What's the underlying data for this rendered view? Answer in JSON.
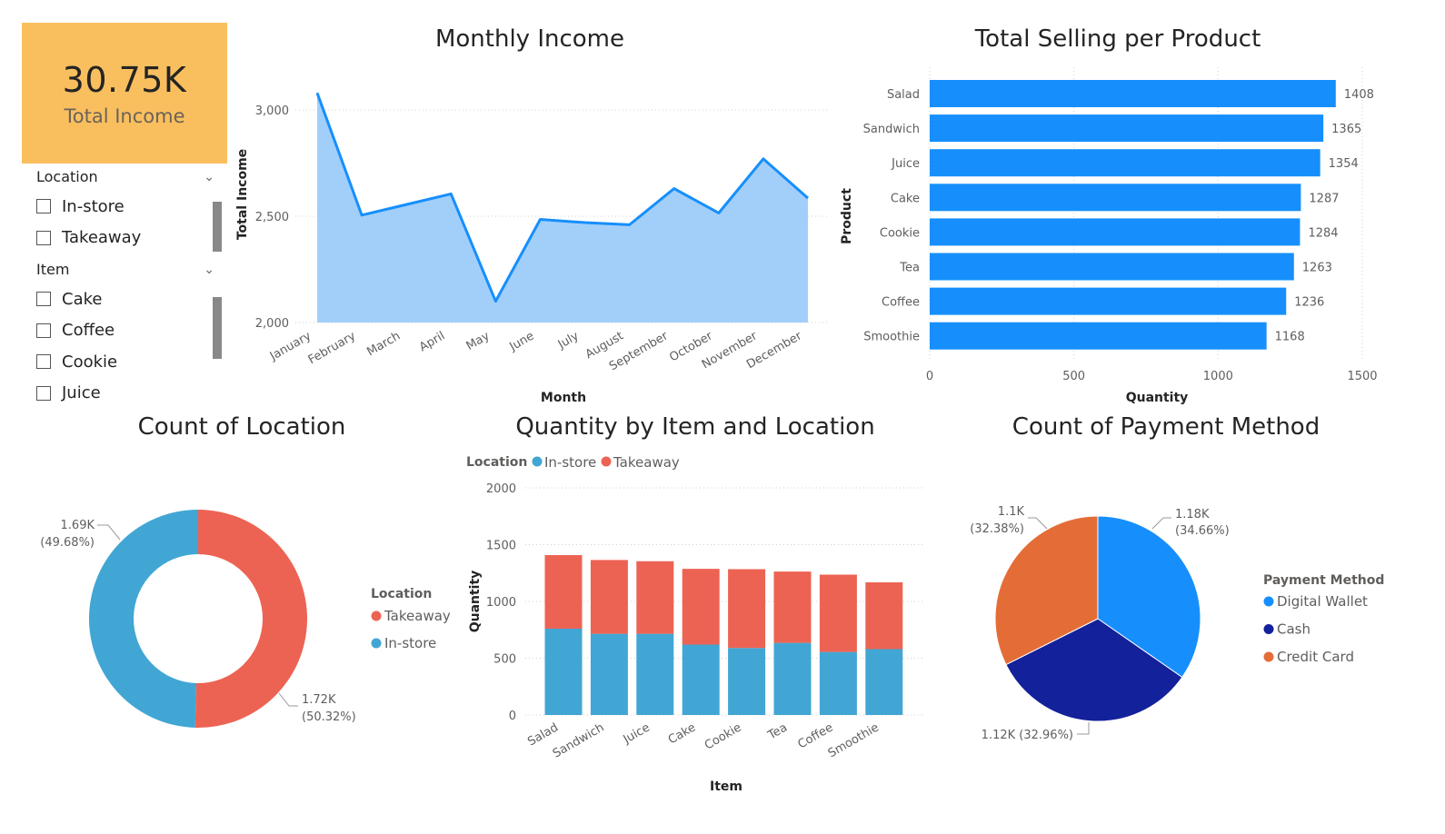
{
  "kpi": {
    "value": "30.75K",
    "label": "Total Income"
  },
  "slicers": {
    "location": {
      "title": "Location",
      "items": [
        "In-store",
        "Takeaway"
      ]
    },
    "item": {
      "title": "Item",
      "items": [
        "Cake",
        "Coffee",
        "Cookie",
        "Juice"
      ]
    }
  },
  "colors": {
    "instore": "#41a6d4",
    "takeaway": "#ed6353",
    "bar": "#168ffc",
    "area_line": "#168ffc",
    "area_fill": "#a2cffa",
    "digital_wallet": "#168ffc",
    "cash": "#13219a",
    "credit_card": "#e46d37",
    "kpi_bg": "#f9bf5f"
  },
  "chart_data": [
    {
      "type": "area",
      "title": "Monthly Income",
      "xlabel": "Month",
      "ylabel": "Total Income",
      "ylim": [
        2000,
        3100
      ],
      "yticks": [
        2000,
        2500,
        3000
      ],
      "ytick_labels": [
        "2,000",
        "2,500",
        "3,000"
      ],
      "categories": [
        "January",
        "February",
        "March",
        "April",
        "May",
        "June",
        "July",
        "August",
        "September",
        "October",
        "November",
        "December"
      ],
      "values": [
        3080,
        2505,
        2555,
        2605,
        2100,
        2485,
        2470,
        2460,
        2630,
        2515,
        2770,
        2585
      ],
      "grid": true
    },
    {
      "type": "bar",
      "orientation": "horizontal",
      "title": "Total Selling per Product",
      "xlabel": "Quantity",
      "ylabel": "Product",
      "xlim": [
        0,
        1500
      ],
      "xticks": [
        0,
        500,
        1000,
        1500
      ],
      "categories": [
        "Salad",
        "Sandwich",
        "Juice",
        "Cake",
        "Cookie",
        "Tea",
        "Coffee",
        "Smoothie"
      ],
      "values": [
        1408,
        1365,
        1354,
        1287,
        1284,
        1263,
        1236,
        1168
      ],
      "data_labels": true,
      "grid": true
    },
    {
      "type": "pie",
      "variant": "donut",
      "title": "Count of Location",
      "legend_title": "Location",
      "legend_position": "right",
      "series": [
        {
          "name": "Takeaway",
          "value": 1720,
          "label": "1.72K",
          "pct": "(50.32%)"
        },
        {
          "name": "In-store",
          "value": 1690,
          "label": "1.69K",
          "pct": "(49.68%)"
        }
      ]
    },
    {
      "type": "bar",
      "variant": "stacked",
      "title": "Quantity by Item and Location",
      "xlabel": "Item",
      "ylabel": "Quantity",
      "legend_title": "Location",
      "legend_position": "top-left",
      "ylim": [
        0,
        2000
      ],
      "yticks": [
        0,
        500,
        1000,
        1500,
        2000
      ],
      "categories": [
        "Salad",
        "Sandwich",
        "Juice",
        "Cake",
        "Cookie",
        "Tea",
        "Coffee",
        "Smoothie"
      ],
      "series": [
        {
          "name": "In-store",
          "values": [
            760,
            715,
            715,
            620,
            590,
            635,
            555,
            580
          ]
        },
        {
          "name": "Takeaway",
          "values": [
            648,
            650,
            639,
            667,
            694,
            628,
            681,
            588
          ]
        }
      ],
      "grid": true
    },
    {
      "type": "pie",
      "title": "Count of Payment Method",
      "legend_title": "Payment Method",
      "legend_position": "right",
      "series": [
        {
          "name": "Digital Wallet",
          "value": 34.66,
          "label": "1.18K",
          "pct": "(34.66%)"
        },
        {
          "name": "Cash",
          "value": 32.96,
          "label": "1.12K (32.96%)",
          "pct": ""
        },
        {
          "name": "Credit Card",
          "value": 32.38,
          "label": "1.1K",
          "pct": "(32.38%)"
        }
      ]
    }
  ]
}
